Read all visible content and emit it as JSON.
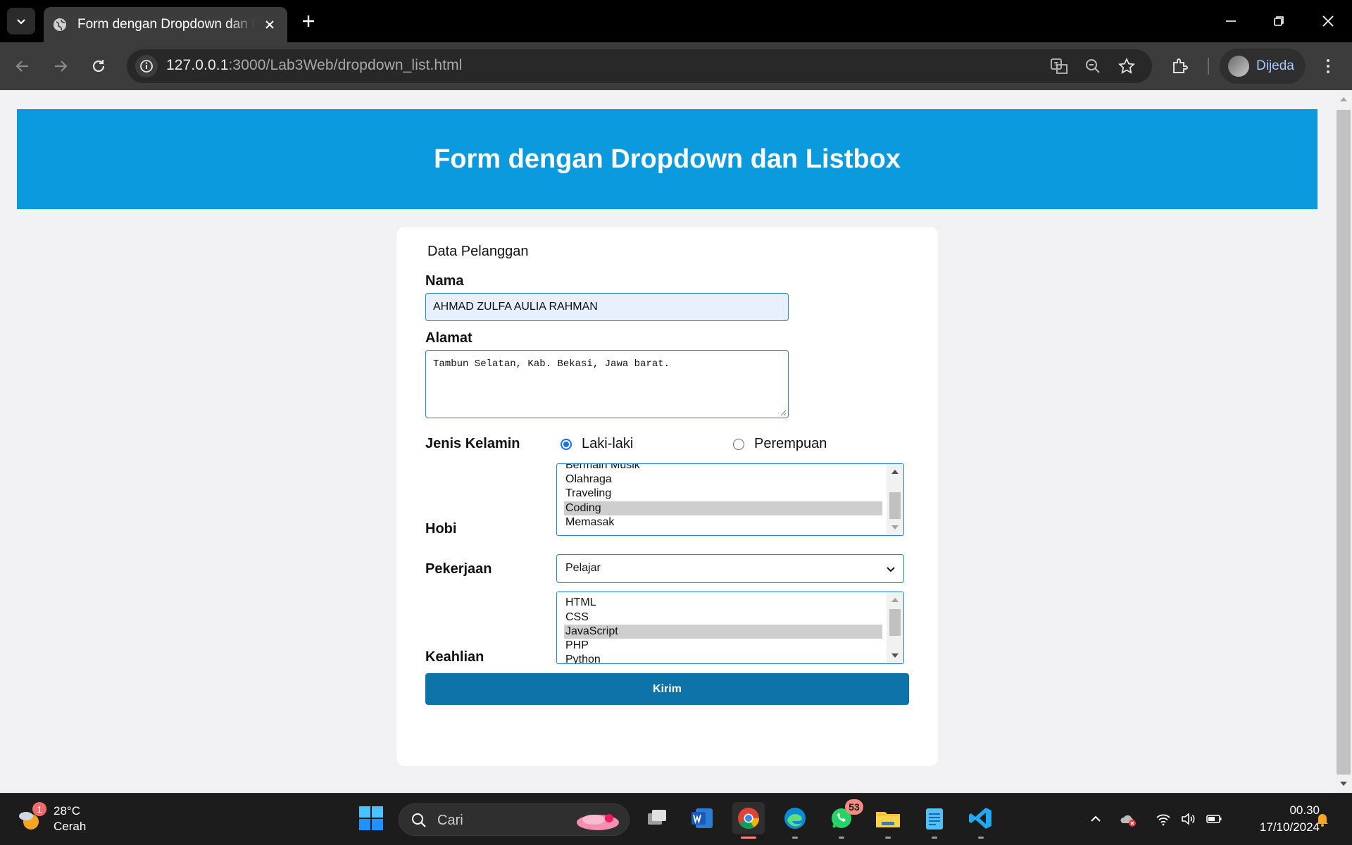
{
  "browser": {
    "tab_title": "Form dengan Dropdown dan List",
    "url_host": "127.0.0.1",
    "url_path": ":3000/Lab3Web/dropdown_list.html",
    "profile_name": "Dijeda"
  },
  "page": {
    "header_title": "Form dengan Dropdown dan Listbox",
    "legend": "Data Pelanggan",
    "nama": {
      "label": "Nama",
      "value": "AHMAD ZULFA AULIA RAHMAN"
    },
    "alamat": {
      "label": "Alamat",
      "value": "Tambun Selatan, Kab. Bekasi, Jawa barat."
    },
    "jenis_kelamin": {
      "label": "Jenis Kelamin",
      "options": [
        "Laki-laki",
        "Perempuan"
      ],
      "selected": "Laki-laki"
    },
    "hobi": {
      "label": "Hobi",
      "visible_options": [
        "Bermain Musik",
        "Olahraga",
        "Traveling",
        "Coding",
        "Memasak"
      ],
      "selected": "Coding"
    },
    "pekerjaan": {
      "label": "Pekerjaan",
      "value": "Pelajar"
    },
    "keahlian": {
      "label": "Keahlian",
      "visible_options": [
        "HTML",
        "CSS",
        "JavaScript",
        "PHP",
        "Python"
      ],
      "selected": "JavaScript"
    },
    "submit_label": "Kirim"
  },
  "taskbar": {
    "weather_temp": "28°C",
    "weather_desc": "Cerah",
    "weather_badge": "1",
    "search_placeholder": "Cari",
    "whatsapp_badge": "53",
    "time": "00.30",
    "date": "17/10/2024"
  },
  "colors": {
    "header_bg": "#0b9ade",
    "submit_bg": "#0e73a8",
    "input_border": "#1b8ad1"
  }
}
